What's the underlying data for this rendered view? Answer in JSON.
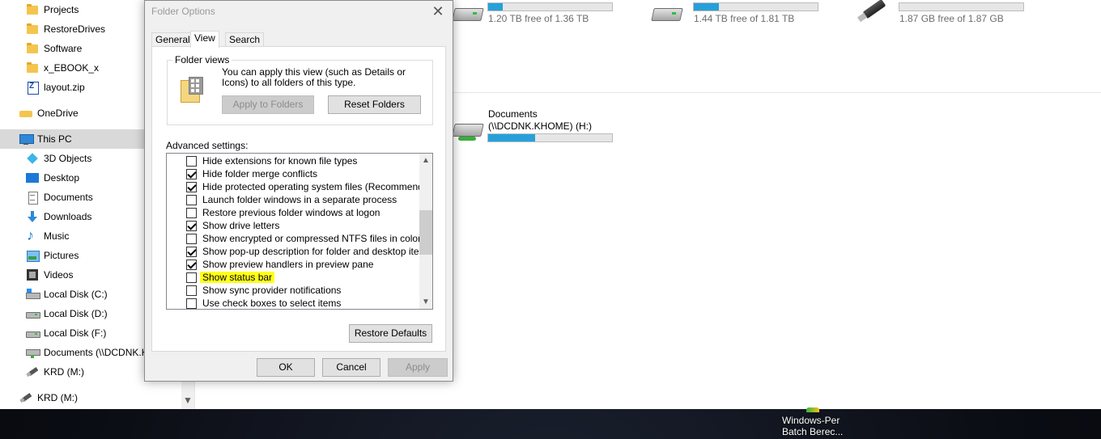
{
  "nav": {
    "items": [
      {
        "label": "Projects",
        "icon": "folder-icon"
      },
      {
        "label": "RestoreDrives",
        "icon": "folder-icon"
      },
      {
        "label": "Software",
        "icon": "folder-icon"
      },
      {
        "label": "x_EBOOK_x",
        "icon": "folder-icon"
      },
      {
        "label": "layout.zip",
        "icon": "zip-file-icon"
      },
      {
        "label": "OneDrive",
        "icon": "onedrive-icon"
      },
      {
        "label": "This PC",
        "icon": "computer-icon"
      },
      {
        "label": "3D Objects",
        "icon": "cube-icon"
      },
      {
        "label": "Desktop",
        "icon": "desktop-icon"
      },
      {
        "label": "Documents",
        "icon": "documents-icon"
      },
      {
        "label": "Downloads",
        "icon": "download-arrow-icon"
      },
      {
        "label": "Music",
        "icon": "music-note-icon"
      },
      {
        "label": "Pictures",
        "icon": "pictures-icon"
      },
      {
        "label": "Videos",
        "icon": "film-icon"
      },
      {
        "label": "Local Disk (C:)",
        "icon": "windows-drive-icon"
      },
      {
        "label": "Local Disk (D:)",
        "icon": "drive-icon"
      },
      {
        "label": "Local Disk (F:)",
        "icon": "drive-icon"
      },
      {
        "label": "Documents (\\\\DCDNK.KHOME) (H:)",
        "icon": "network-drive-icon"
      },
      {
        "label": "KRD (M:)",
        "icon": "usb-drive-icon"
      },
      {
        "label": "KRD (M:)",
        "icon": "usb-drive-icon"
      }
    ]
  },
  "drives": [
    {
      "free_text": "1.20 TB free of 1.36 TB",
      "used_fraction": 0.12,
      "icon": "hard-drive-icon"
    },
    {
      "free_text": "1.44 TB free of 1.81 TB",
      "used_fraction": 0.2,
      "icon": "hard-drive-icon"
    },
    {
      "free_text": "1.87 GB free of 1.87 GB",
      "used_fraction": 0.0,
      "icon": "usb-drive-icon"
    }
  ],
  "network_location": {
    "name_line1": "Documents",
    "name_line2": "(\\\\DCDNK.KHOME) (H:)",
    "used_fraction": 0.38,
    "icon": "network-drive-icon"
  },
  "dialog": {
    "title": "Folder Options",
    "close_glyph": "✕",
    "tabs": [
      "General",
      "View",
      "Search"
    ],
    "active_tab": "View",
    "folder_views": {
      "label": "Folder views",
      "description": "You can apply this view (such as Details or Icons) to all folders of this type.",
      "apply_button": "Apply to Folders",
      "reset_button": "Reset Folders"
    },
    "advanced_label": "Advanced settings:",
    "settings": [
      {
        "label": "Hide extensions for known file types",
        "checked": false
      },
      {
        "label": "Hide folder merge conflicts",
        "checked": true
      },
      {
        "label": "Hide protected operating system files (Recommended)",
        "checked": true
      },
      {
        "label": "Launch folder windows in a separate process",
        "checked": false
      },
      {
        "label": "Restore previous folder windows at logon",
        "checked": false
      },
      {
        "label": "Show drive letters",
        "checked": true
      },
      {
        "label": "Show encrypted or compressed NTFS files in color",
        "checked": false
      },
      {
        "label": "Show pop-up description for folder and desktop items",
        "checked": true
      },
      {
        "label": "Show preview handlers in preview pane",
        "checked": true
      },
      {
        "label": "Show status bar",
        "checked": false,
        "highlighted": true
      },
      {
        "label": "Show sync provider notifications",
        "checked": false
      },
      {
        "label": "Use check boxes to select items",
        "checked": false
      }
    ],
    "restore_defaults": "Restore Defaults",
    "ok": "OK",
    "cancel": "Cancel",
    "apply": "Apply",
    "scroll_up_glyph": "▲",
    "scroll_down_glyph": "▼"
  },
  "desktop": {
    "shortcut_line1": "Windows-Per",
    "shortcut_line2": "Batch Berec..."
  },
  "nav_scroll_down_glyph": "▼",
  "colors": {
    "highlight": "#ffff1a",
    "drive_bar_fill": "#26a0da",
    "selected_nav": "#d9d9d9"
  }
}
